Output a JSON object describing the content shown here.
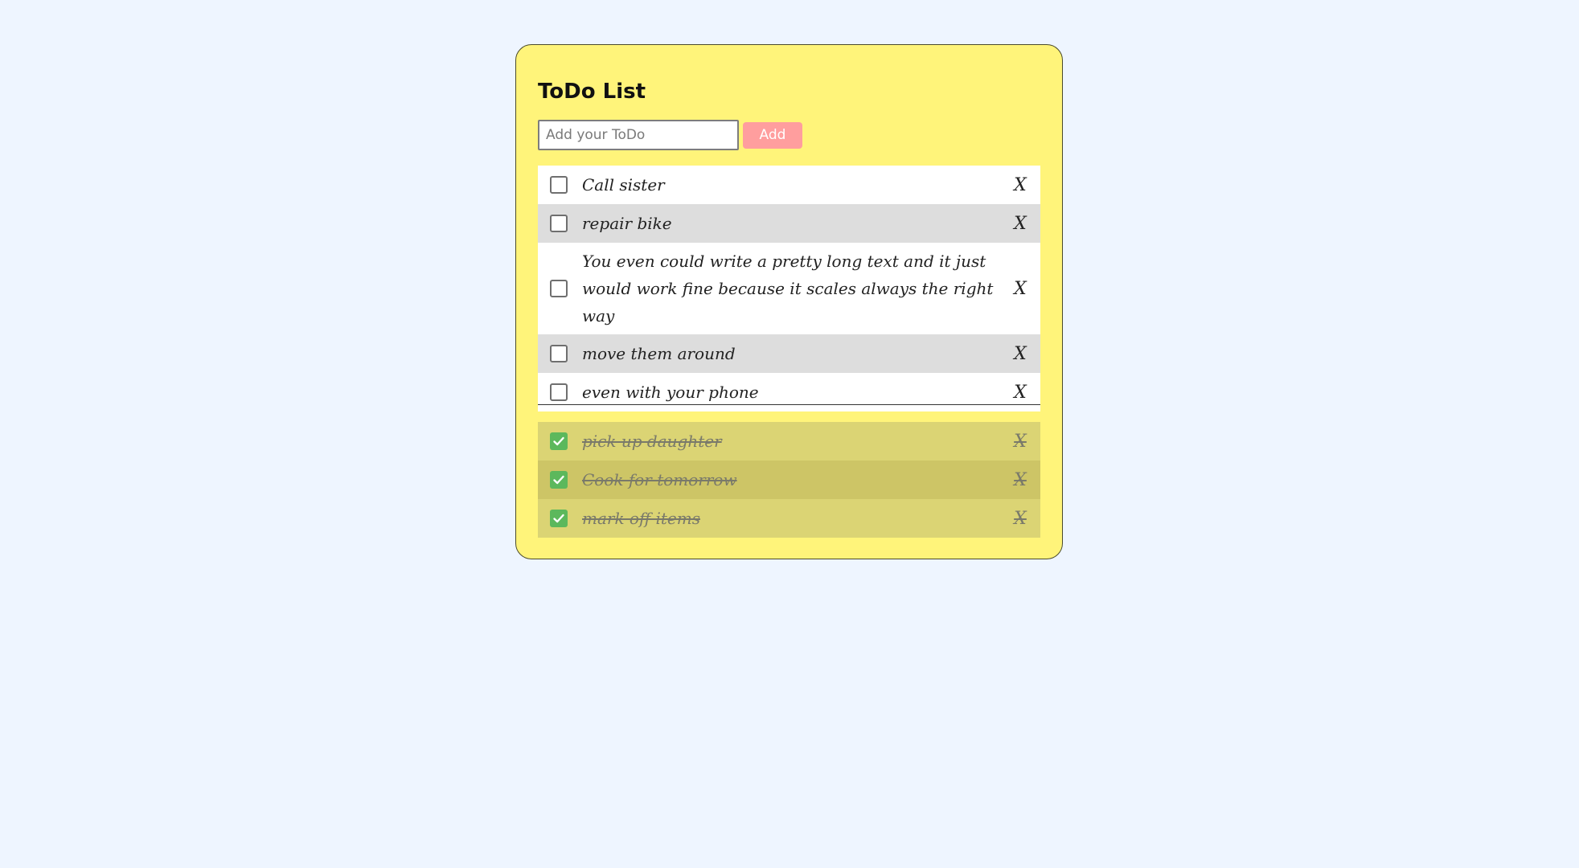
{
  "app": {
    "title": "ToDo List"
  },
  "input": {
    "placeholder": "Add your ToDo",
    "value": ""
  },
  "add_button": {
    "label": "Add"
  },
  "open_todos": [
    {
      "text": "Call sister",
      "delete_label": "X"
    },
    {
      "text": "repair bike",
      "delete_label": "X"
    },
    {
      "text": "You even could write a pretty long text and it just would work fine because it scales always the right way",
      "delete_label": "X"
    },
    {
      "text": "move them around",
      "delete_label": "X"
    },
    {
      "text": "even with your phone",
      "delete_label": "X"
    }
  ],
  "done_todos": [
    {
      "text": "pick up daughter",
      "delete_label": "X"
    },
    {
      "text": "Cook for tomorrow",
      "delete_label": "X"
    },
    {
      "text": "mark off items",
      "delete_label": "X"
    }
  ],
  "colors": {
    "page_background": "#eef5ff",
    "card_background": "#fff47a",
    "add_button": "#ff9e9e",
    "checked": "#5cb85c"
  }
}
